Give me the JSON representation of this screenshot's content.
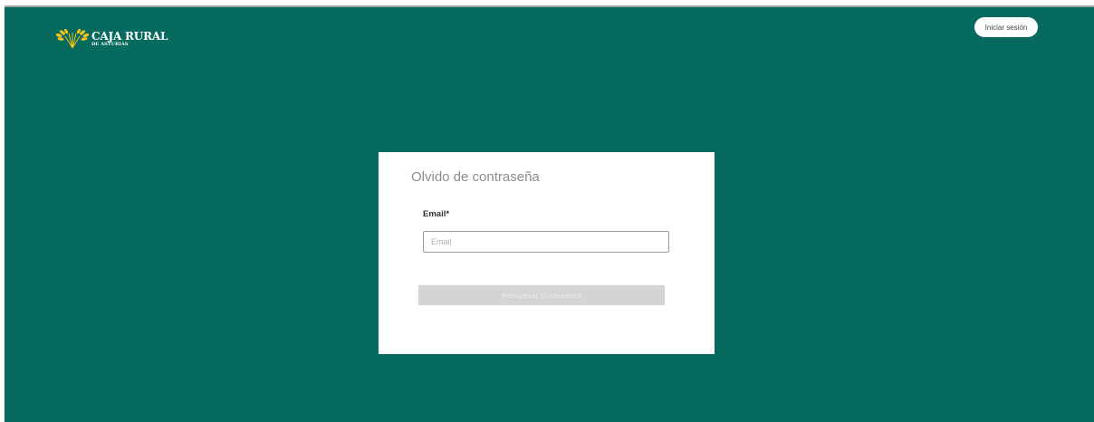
{
  "header": {
    "logo": {
      "icon": "wheat-icon",
      "name": "CAJA RURAL",
      "subtitle": "DE ASTURIAS"
    },
    "login_button": "Iniciar sesión"
  },
  "form": {
    "title": "Olvido de contraseña",
    "email_label": "Email*",
    "email_value": "",
    "email_placeholder": "Email",
    "submit_label": "Recuperar Contraseña",
    "submit_disabled": true
  },
  "colors": {
    "background": "#076a5f",
    "logo_accent": "#f2c21b",
    "card": "#ffffff",
    "button_disabled": "#d4d4d4"
  }
}
